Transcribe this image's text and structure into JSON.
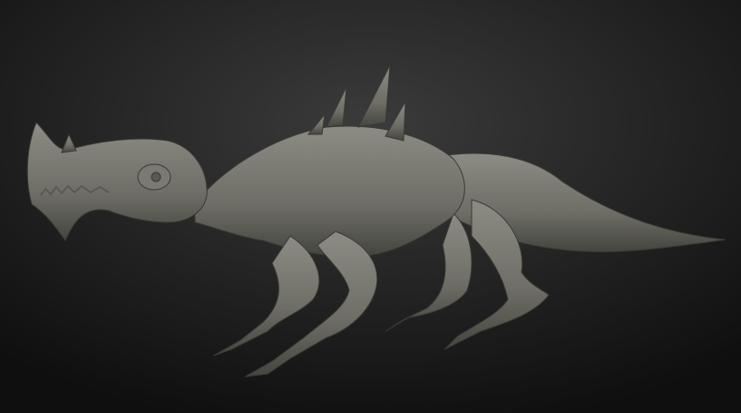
{
  "scene": {
    "subject": "creature-sculpt",
    "colors": {
      "background_center": "#3b3b3b",
      "background_edge": "#0f0f0f",
      "clay_light": "#8c8c84",
      "clay_mid": "#6e6e67",
      "clay_dark": "#45453f"
    }
  }
}
